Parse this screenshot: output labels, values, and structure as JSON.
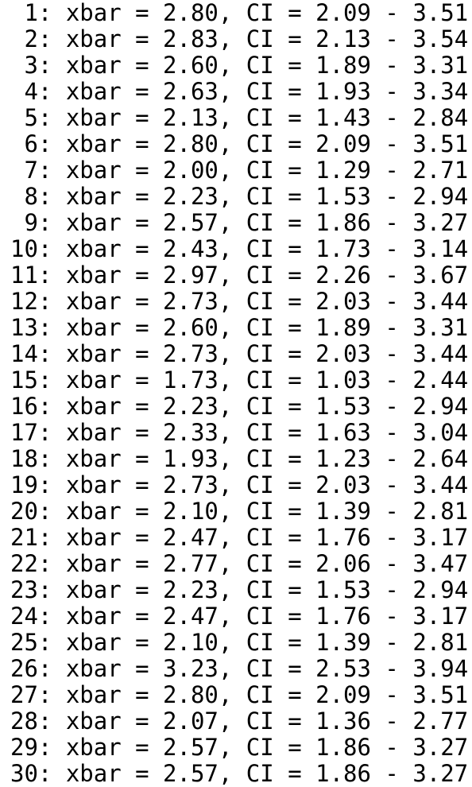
{
  "console": {
    "lines": [
      " 1: xbar = 2.80, CI = 2.09 - 3.51",
      " 2: xbar = 2.83, CI = 2.13 - 3.54",
      " 3: xbar = 2.60, CI = 1.89 - 3.31",
      " 4: xbar = 2.63, CI = 1.93 - 3.34",
      " 5: xbar = 2.13, CI = 1.43 - 2.84",
      " 6: xbar = 2.80, CI = 2.09 - 3.51",
      " 7: xbar = 2.00, CI = 1.29 - 2.71",
      " 8: xbar = 2.23, CI = 1.53 - 2.94",
      " 9: xbar = 2.57, CI = 1.86 - 3.27",
      "10: xbar = 2.43, CI = 1.73 - 3.14",
      "11: xbar = 2.97, CI = 2.26 - 3.67",
      "12: xbar = 2.73, CI = 2.03 - 3.44",
      "13: xbar = 2.60, CI = 1.89 - 3.31",
      "14: xbar = 2.73, CI = 2.03 - 3.44",
      "15: xbar = 1.73, CI = 1.03 - 2.44",
      "16: xbar = 2.23, CI = 1.53 - 2.94",
      "17: xbar = 2.33, CI = 1.63 - 3.04",
      "18: xbar = 1.93, CI = 1.23 - 2.64",
      "19: xbar = 2.73, CI = 2.03 - 3.44",
      "20: xbar = 2.10, CI = 1.39 - 2.81",
      "21: xbar = 2.47, CI = 1.76 - 3.17",
      "22: xbar = 2.77, CI = 2.06 - 3.47",
      "23: xbar = 2.23, CI = 1.53 - 2.94",
      "24: xbar = 2.47, CI = 1.76 - 3.17",
      "25: xbar = 2.10, CI = 1.39 - 2.81",
      "26: xbar = 3.23, CI = 2.53 - 3.94",
      "27: xbar = 2.80, CI = 2.09 - 3.51",
      "28: xbar = 2.07, CI = 1.36 - 2.77",
      "29: xbar = 2.57, CI = 1.86 - 3.27",
      "30: xbar = 2.57, CI = 1.86 - 3.27"
    ]
  }
}
